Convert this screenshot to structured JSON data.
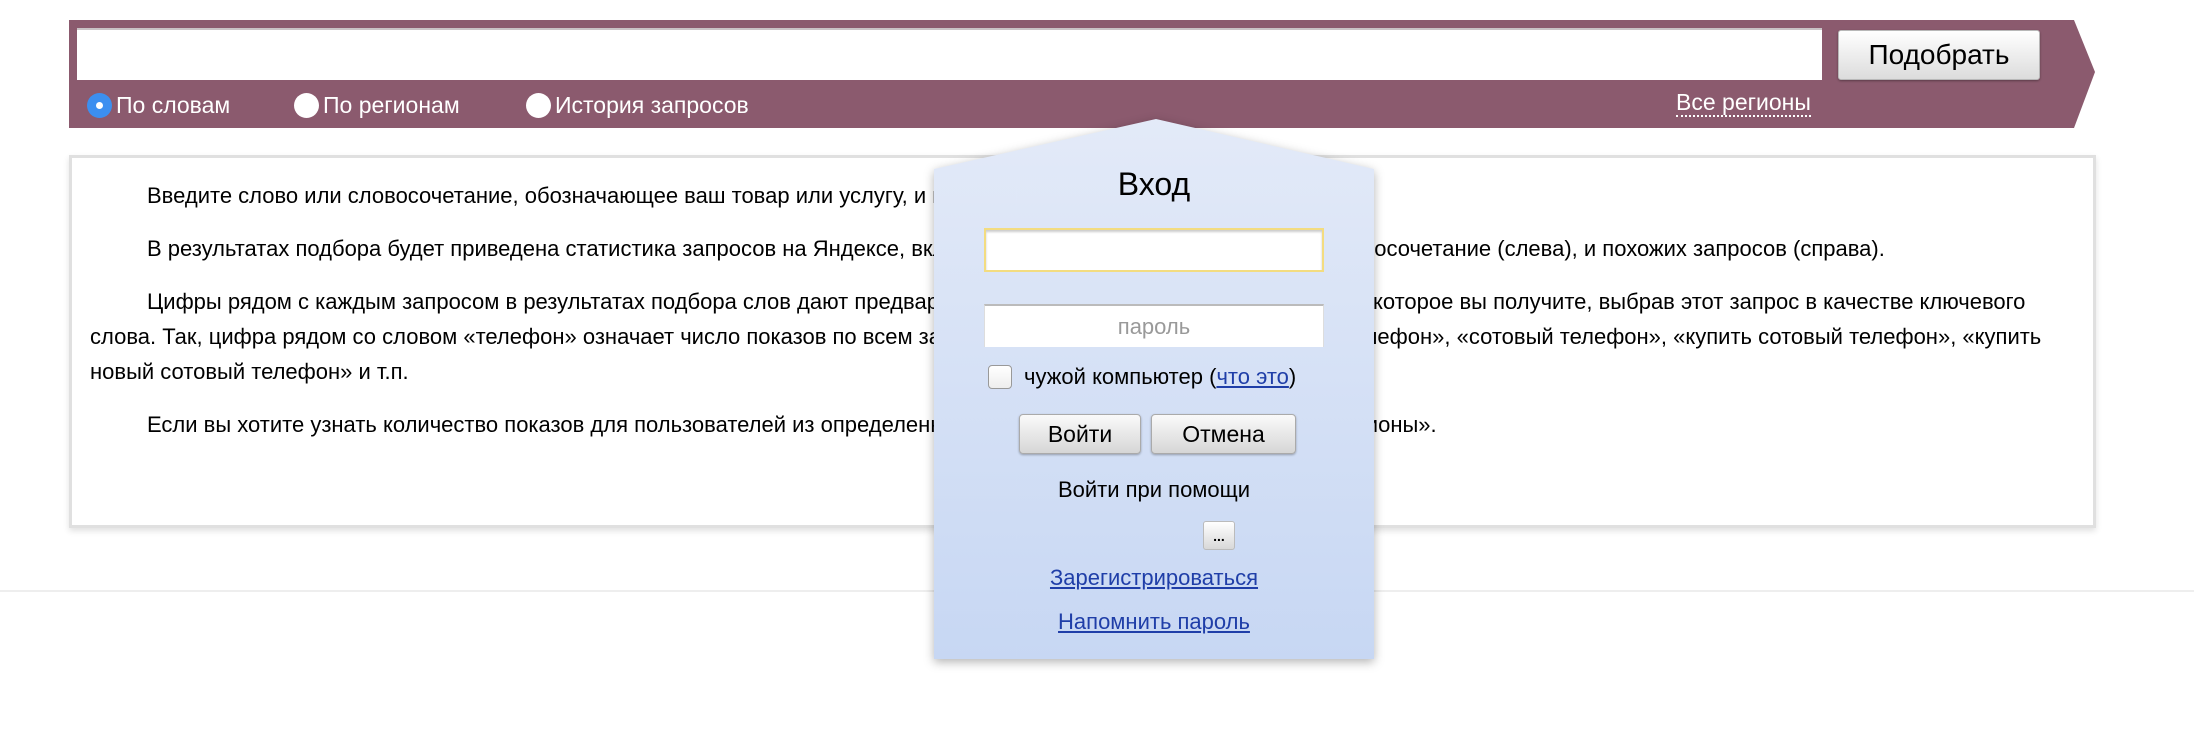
{
  "search": {
    "query_value": "",
    "submit_label": "Подобрать",
    "modes": [
      {
        "label": "По словам",
        "selected": true
      },
      {
        "label": "По регионам",
        "selected": false
      },
      {
        "label": "История запросов",
        "selected": false
      }
    ],
    "region_link": "Все регионы"
  },
  "help": {
    "paragraphs": [
      "Введите слово или словосочетание, обозначающее ваш товар или услугу, и нажмите кнопку «Подобрать».",
      "В результатах подбора будет приведена статистика запросов на Яндексе, включающих указанное вами слово или словосочетание (слева), и похожих запросов (справа).",
      "Цифры рядом с каждым запросом в результатах подбора слов дают предварительный прогноз числа показов в месяц, которое вы получите, выбрав этот запрос в качестве ключевого слова. Так, цифра рядом со словом «телефон» означает число показов по всем запросам со словом «телефон»: «купить телефон», «сотовый телефон», «купить сотовый телефон», «купить новый сотовый телефон» и т.п.",
      "Если вы хотите узнать количество показов для пользователей из определенного региона, нажмите на ссылку «Все регионы»."
    ]
  },
  "login_popup": {
    "title": "Вход",
    "login_value": "",
    "password_placeholder": "пароль",
    "foreign_computer_label": "чужой компьютер (",
    "what_is_it_link": "что это",
    "close_paren": ")",
    "login_button": "Войти",
    "cancel_button": "Отмена",
    "login_via_label": "Войти при помощи",
    "more_button": "...",
    "register_link": "Зарегистрироваться",
    "remind_password_link": "Напомнить пароль"
  },
  "colors": {
    "bar": "#8b5a6e",
    "link": "#1f3ea8",
    "radio_selected": "#3c8ff0"
  }
}
